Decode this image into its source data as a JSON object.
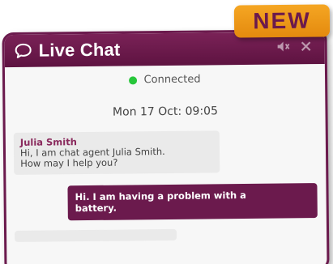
{
  "header": {
    "title": "Live Chat",
    "icon": "speech-bubble-icon",
    "controls": [
      "mute-icon",
      "close-icon"
    ]
  },
  "status": {
    "text": "Connected",
    "color": "#27c63a"
  },
  "timestamp": "Mon 17 Oct:  09:05",
  "messages": [
    {
      "sender": "Julia Smith",
      "lines": [
        "Hi, I am chat agent Julia Smith.",
        "How may I help you?"
      ]
    },
    {
      "lines": [
        "Hi. I am having a problem with a",
        "battery."
      ]
    }
  ],
  "badge": {
    "text": "NEW",
    "color": "#f5a623"
  },
  "colors": {
    "brand": "#6b1a4d",
    "accent": "#f5a623"
  }
}
